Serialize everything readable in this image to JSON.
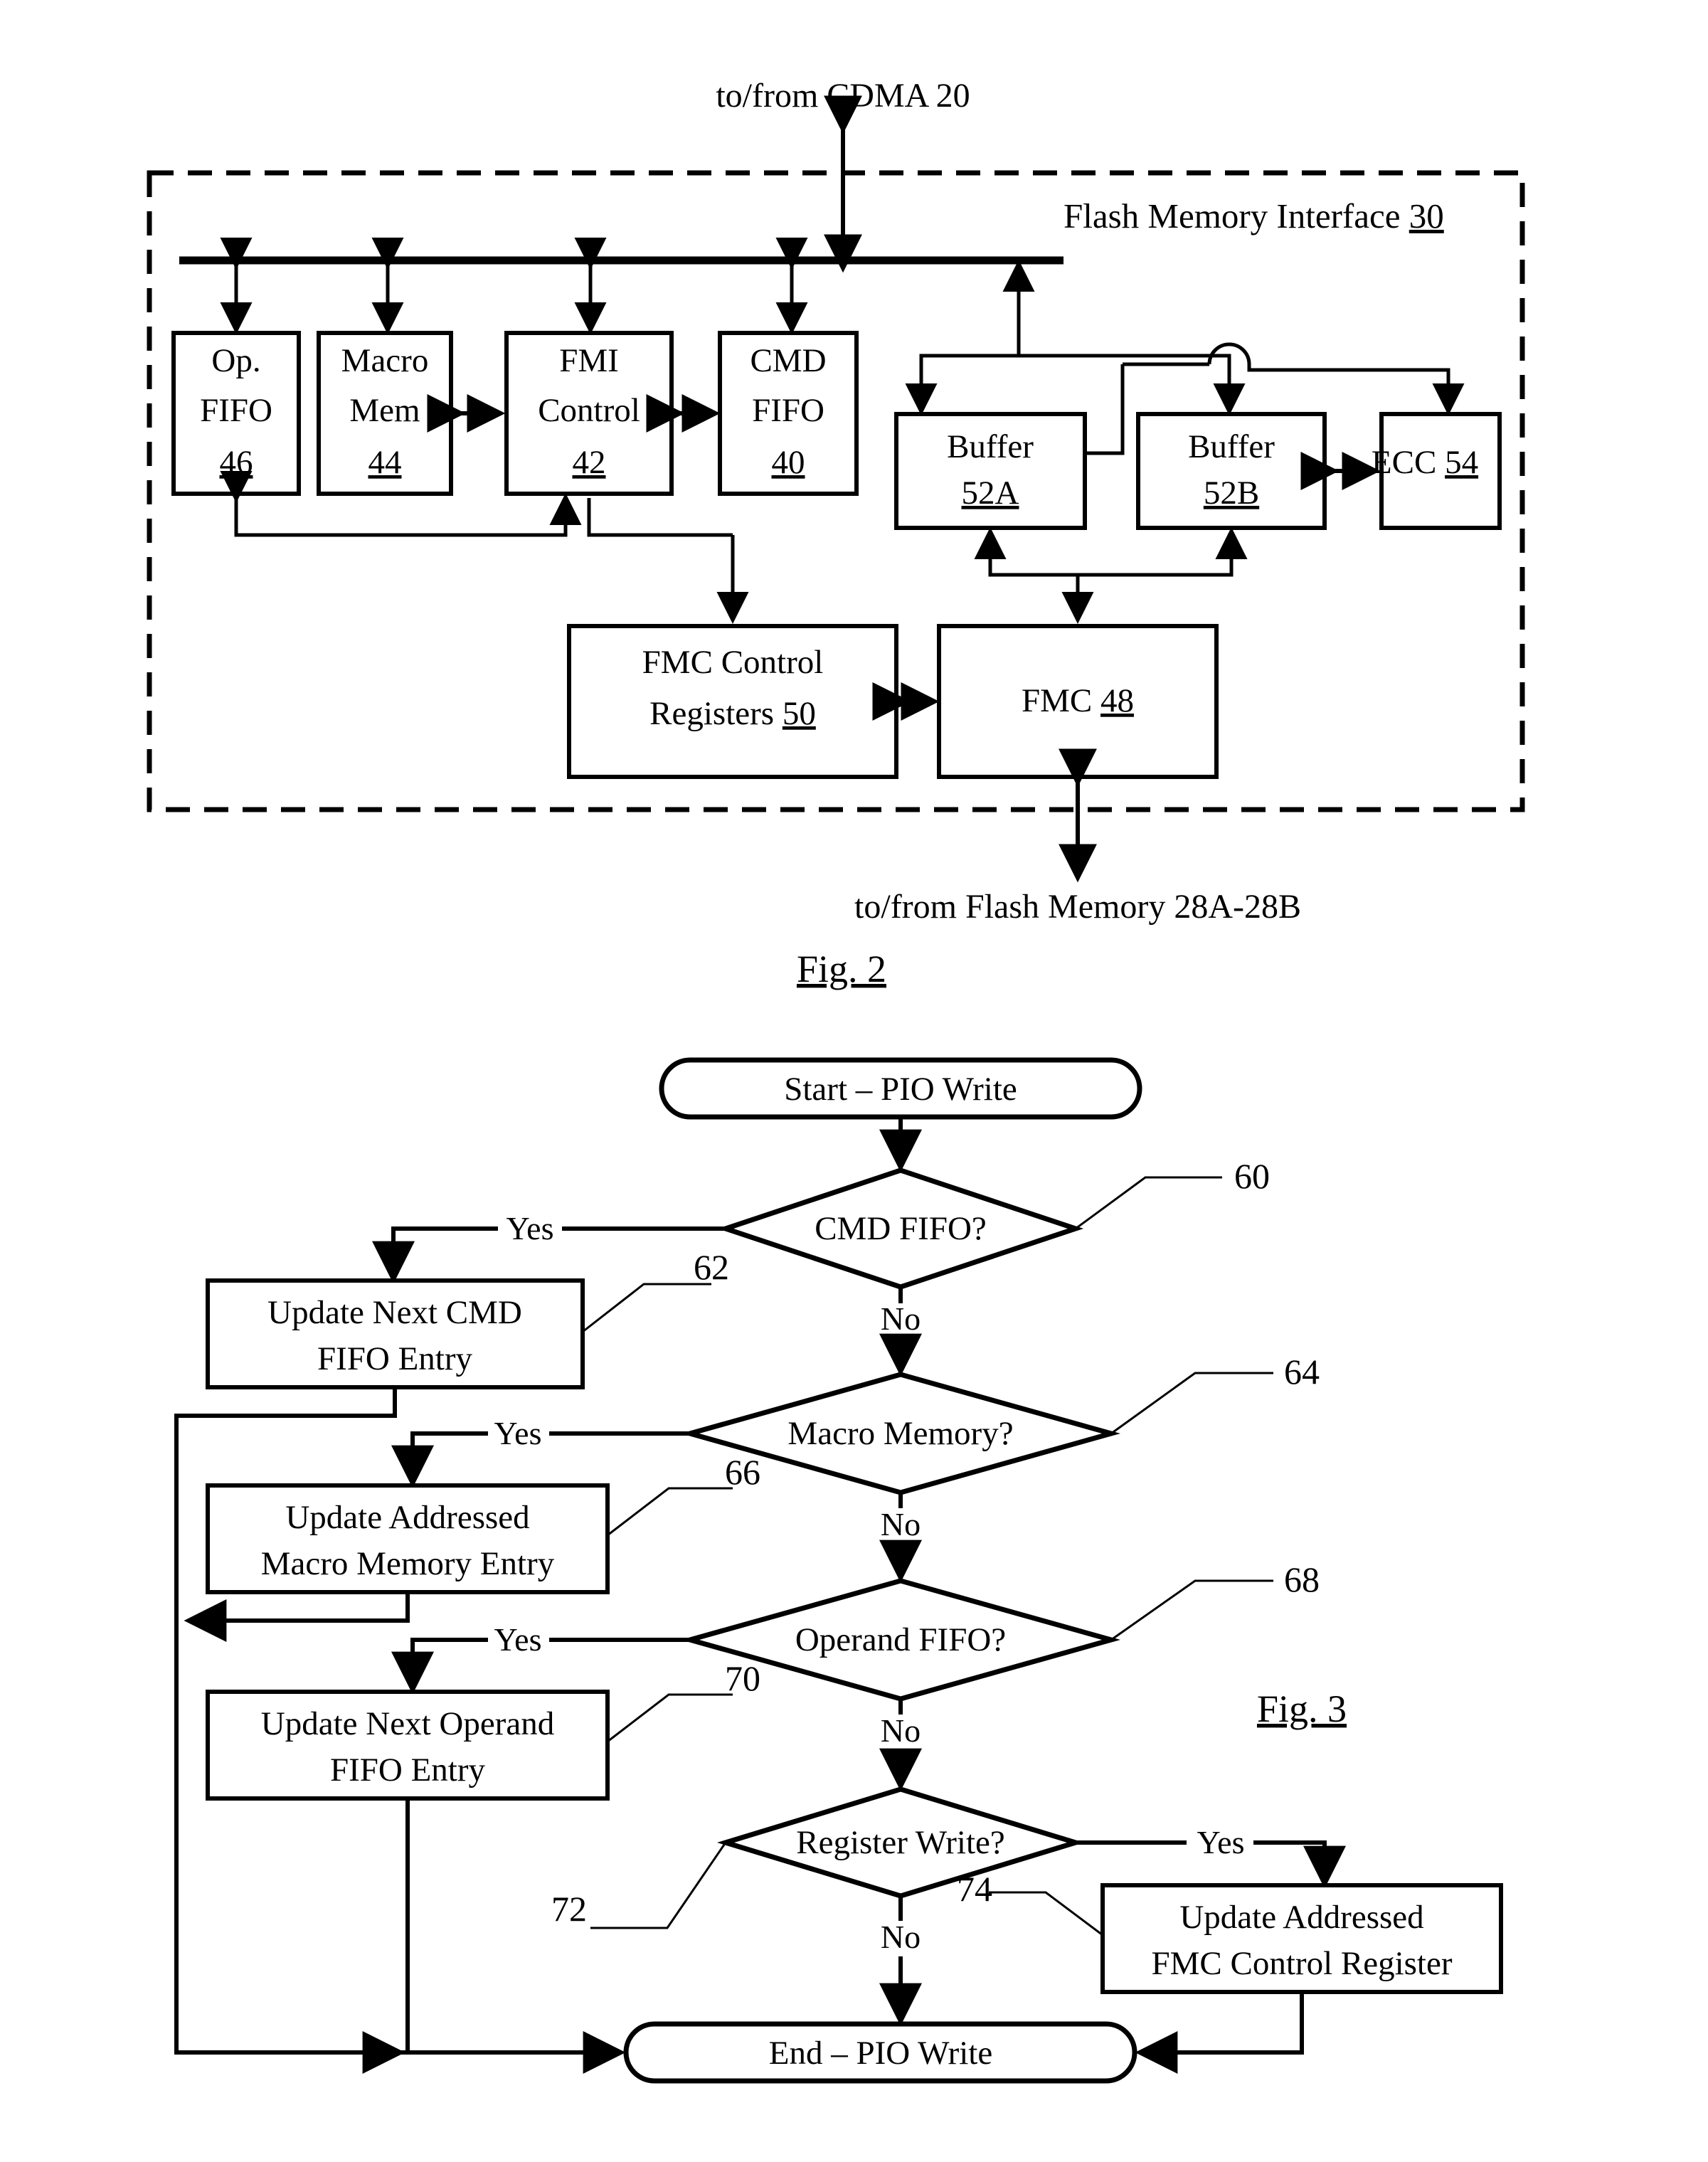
{
  "figure2": {
    "caption": "Fig. 2",
    "top_label": "to/from CDMA 20",
    "bottom_label": "to/from Flash Memory 28A-28B",
    "enclosure_label": "Flash Memory Interface",
    "enclosure_ref": "30",
    "blocks": [
      {
        "id": "op-fifo",
        "line1": "Op.",
        "line2": "FIFO",
        "ref": "46"
      },
      {
        "id": "macro-mem",
        "line1": "Macro",
        "line2": "Mem",
        "ref": "44"
      },
      {
        "id": "fmi-control",
        "line1": "FMI",
        "line2": "Control",
        "ref": "42"
      },
      {
        "id": "cmd-fifo",
        "line1": "CMD",
        "line2": "FIFO",
        "ref": "40"
      },
      {
        "id": "buffer-52a",
        "line1": "Buffer",
        "line2": "",
        "ref": "52A"
      },
      {
        "id": "buffer-52b",
        "line1": "Buffer",
        "line2": "",
        "ref": "52B"
      },
      {
        "id": "ecc-54",
        "line1": "ECC",
        "line2": "",
        "ref": "54"
      },
      {
        "id": "fmc-control-registers",
        "line1": "FMC Control",
        "line2": "Registers",
        "ref": "50"
      },
      {
        "id": "fmc-48",
        "line1": "FMC",
        "line2": "",
        "ref": "48"
      }
    ]
  },
  "figure3": {
    "caption": "Fig. 3",
    "start": "Start – PIO Write",
    "end": "End – PIO Write",
    "yes": "Yes",
    "no": "No",
    "decisions": [
      {
        "id": "cmd-fifo",
        "label": "CMD FIFO?",
        "ref": "60"
      },
      {
        "id": "macro-memory",
        "label": "Macro Memory?",
        "ref": "64"
      },
      {
        "id": "operand-fifo",
        "label": "Operand FIFO?",
        "ref": "68"
      },
      {
        "id": "register-write",
        "label": "Register Write?",
        "ref": "72"
      }
    ],
    "actions": [
      {
        "id": "update-cmd-fifo-entry",
        "line1": "Update Next CMD",
        "line2": "FIFO Entry",
        "ref": "62"
      },
      {
        "id": "update-macro-memory",
        "line1": "Update Addressed",
        "line2": "Macro Memory Entry",
        "ref": "66"
      },
      {
        "id": "update-operand-fifo-entry",
        "line1": "Update Next Operand",
        "line2": "FIFO Entry",
        "ref": "70"
      },
      {
        "id": "update-fmc-control-reg",
        "line1": "Update Addressed",
        "line2": "FMC Control Register",
        "ref": "74"
      }
    ]
  },
  "colors": {
    "ink": "#000000",
    "paper": "#ffffff"
  }
}
